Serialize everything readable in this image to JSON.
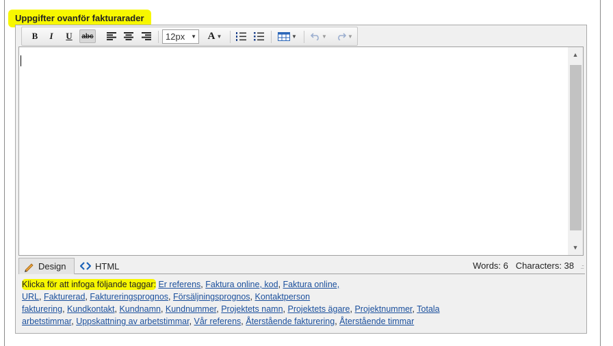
{
  "section_title": "Uppgifter ovanför fakturarader",
  "toolbar": {
    "bold": "B",
    "italic": "I",
    "underline": "U",
    "strike": "abc",
    "font_size": "12px",
    "font_color_letter": "A"
  },
  "icons": {
    "align_left": "align-left-icon",
    "align_center": "align-center-icon",
    "align_right": "align-right-icon",
    "numbered_list": "numbered-list-icon",
    "bullet_list": "bullet-list-icon",
    "table": "table-icon",
    "undo": "undo-icon",
    "redo": "redo-icon"
  },
  "modes": {
    "design_label": "Design",
    "html_label": "HTML"
  },
  "stats": {
    "words_label": "Words: 6",
    "characters_label": "Characters: 38"
  },
  "tags": {
    "prompt": "Klicka för att infoga följande taggar:",
    "line1": [
      "Er referens",
      "Faktura online, kod",
      "Faktura online,"
    ],
    "line2": [
      "URL",
      "Fakturerad",
      "Faktureringsprognos",
      "Försäljningsprognos",
      "Kontaktperson"
    ],
    "line3_lead": "fakturering",
    "line3": [
      "Kundkontakt",
      "Kundnamn",
      "Kundnummer",
      "Projektets namn",
      "Projektets ägare",
      "Projektnummer",
      "Totala"
    ],
    "line4_lead": "arbetstimmar",
    "line4": [
      "Uppskattning av arbetstimmar",
      "Vår referens",
      "Återstående fakturering",
      "Återstående timmar"
    ]
  },
  "colors": {
    "highlight": "#f7f700",
    "link": "#1a4f9c",
    "html_icon": "#1a62b8"
  }
}
